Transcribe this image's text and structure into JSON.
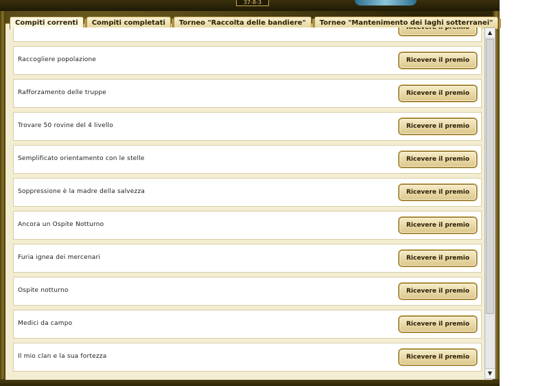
{
  "window": {
    "top_marker": "37-8-3"
  },
  "tabs": [
    {
      "label": "Compiti correnti",
      "active": true
    },
    {
      "label": "Compiti completati",
      "active": false
    },
    {
      "label": "Torneo \"Raccolta delle bandiere\"",
      "active": false
    },
    {
      "label": "Torneo \"Mantenimento dei laghi sotterranei\"",
      "active": false
    }
  ],
  "list": {
    "partial_top_label": "Ricevere il premio",
    "items": [
      {
        "label": "Raccogliere popolazione",
        "button": "Ricevere il premio"
      },
      {
        "label": "Rafforzamento delle truppe",
        "button": "Ricevere il premio"
      },
      {
        "label": "Trovare 50 rovine del 4 livello",
        "button": "Ricevere il premio"
      },
      {
        "label": "Semplificato orientamento con le stelle",
        "button": "Ricevere il premio"
      },
      {
        "label": "Soppressione è la madre della salvezza",
        "button": "Ricevere il premio"
      },
      {
        "label": "Ancora un Ospite Notturno",
        "button": "Ricevere il premio"
      },
      {
        "label": "Furia ignea dei mercenari",
        "button": "Ricevere il premio"
      },
      {
        "label": "Ospite notturno",
        "button": "Ricevere il premio"
      },
      {
        "label": "Medici da campo",
        "button": "Ricevere il premio"
      },
      {
        "label": "Il mio clan e la sua fortezza",
        "button": "Ricevere il premio"
      }
    ]
  },
  "scrollbar": {
    "up_icon": "triangle-up",
    "down_icon": "triangle-down"
  },
  "colors": {
    "panel": "#f3edd2",
    "button": "#e8d9a8",
    "frame": "#4b3f10"
  }
}
